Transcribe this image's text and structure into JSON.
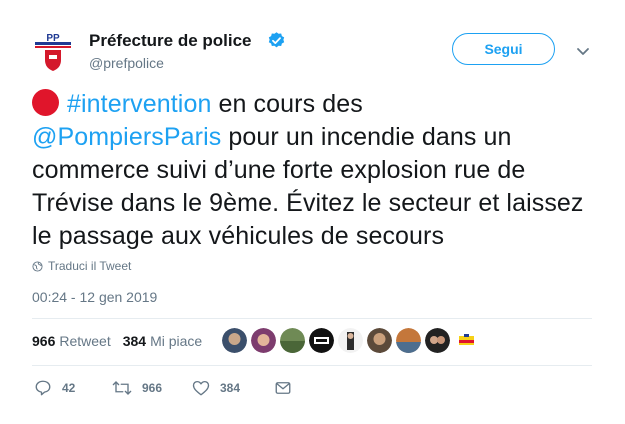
{
  "tweet": {
    "display_name": "Préfecture de police",
    "handle": "@prefpolice",
    "follow_label": "Segui",
    "text": {
      "hashtag": "#intervention",
      "part1": " en cours des ",
      "mention": "@PompiersParis",
      "part2": " pour un incendie dans un commerce suivi d’une forte explosion rue de Trévise dans le 9ème. Évitez le secteur et laissez le passage aux véhicules de secours"
    },
    "translate_label": "Traduci il Tweet",
    "timestamp": "00:24 - 12 gen 2019"
  },
  "stats": {
    "retweets_count": "966",
    "retweets_label": "Retweet",
    "likes_count": "384",
    "likes_label": "Mi piace"
  },
  "actions": {
    "reply_count": "42",
    "retweet_count": "966",
    "like_count": "384"
  },
  "colors": {
    "accent": "#1da1f2",
    "alert_dot": "#e0152b",
    "muted": "#657786"
  },
  "icons": [
    "verified-badge-icon",
    "chevron-down-icon",
    "globe-icon",
    "reply-icon",
    "retweet-icon",
    "heart-icon",
    "direct-message-icon"
  ]
}
